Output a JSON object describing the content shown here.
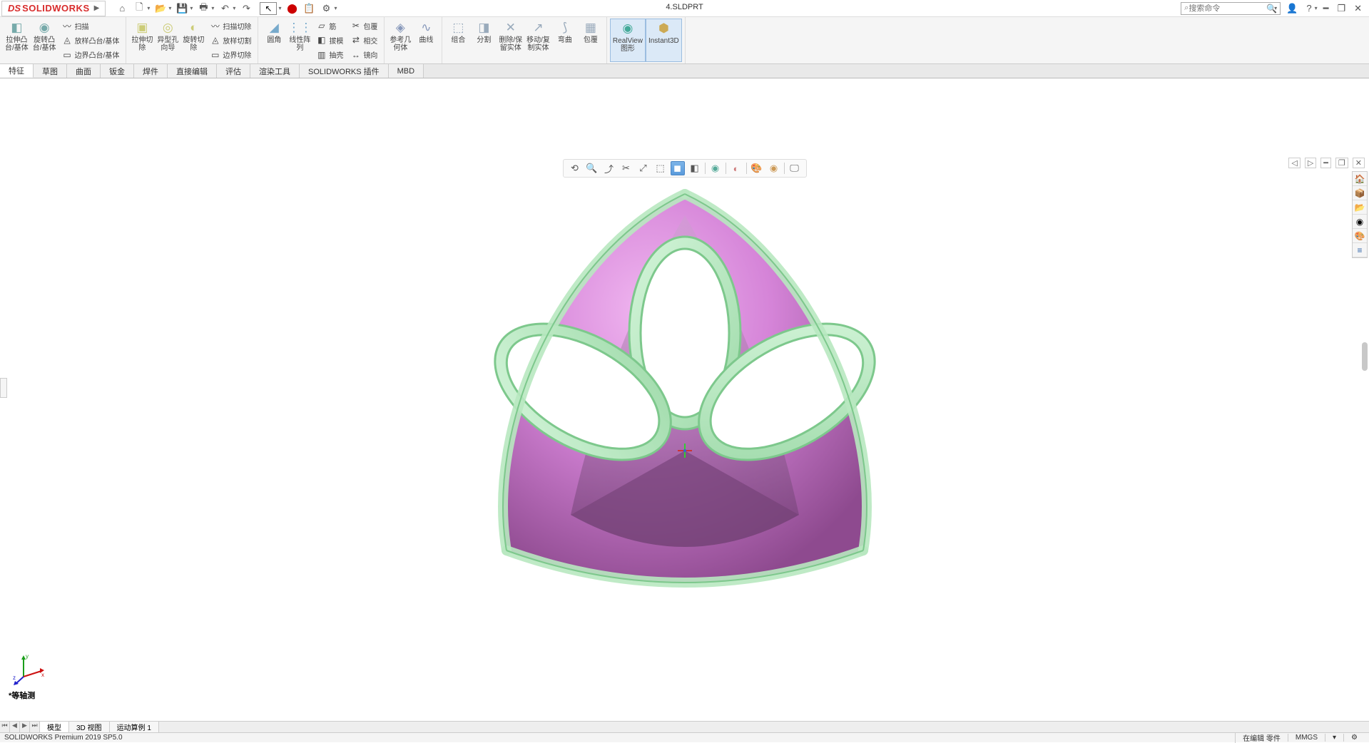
{
  "app": {
    "logo_prefix": "DS",
    "logo_text": "SOLIDWORKS",
    "document_title": "4.SLDPRT",
    "search_placeholder": "搜索命令"
  },
  "qat_icons": [
    "home",
    "new",
    "open",
    "save",
    "print",
    "undo",
    "redo"
  ],
  "ribbon": {
    "groups": {
      "features1": [
        {
          "icon": "◧",
          "label": "拉伸凸\n台/基体"
        },
        {
          "icon": "◉",
          "label": "旋转凸\n台/基体"
        }
      ],
      "features1_stack": [
        {
          "icon": "〰",
          "label": "扫描"
        },
        {
          "icon": "◬",
          "label": "放样凸台/基体"
        },
        {
          "icon": "▭",
          "label": "边界凸台/基体"
        }
      ],
      "features2": [
        {
          "icon": "▣",
          "label": "拉伸切\n除"
        },
        {
          "icon": "◎",
          "label": "异型孔\n向导"
        },
        {
          "icon": "◐",
          "label": "旋转切\n除"
        }
      ],
      "features2_stack": [
        {
          "icon": "〰",
          "label": "扫描切除"
        },
        {
          "icon": "◬",
          "label": "放样切割"
        },
        {
          "icon": "▭",
          "label": "边界切除"
        }
      ],
      "features3": [
        {
          "icon": "◢",
          "label": "圆角"
        },
        {
          "icon": "⋮⋮",
          "label": "线性阵\n列"
        }
      ],
      "features3_stack": [
        {
          "icon": "▱",
          "label": "筋"
        },
        {
          "icon": "◧",
          "label": "拔模"
        },
        {
          "icon": "▥",
          "label": "抽壳"
        }
      ],
      "features3_stack2": [
        {
          "icon": "✂",
          "label": "包覆"
        },
        {
          "icon": "⇄",
          "label": "相交"
        },
        {
          "icon": "↔",
          "label": "镜向"
        }
      ],
      "ref": [
        {
          "icon": "◈",
          "label": "参考几\n何体"
        },
        {
          "icon": "∿",
          "label": "曲线"
        }
      ],
      "bodies": [
        {
          "icon": "⬚",
          "label": "组合"
        },
        {
          "icon": "◨",
          "label": "分割"
        },
        {
          "icon": "✕",
          "label": "删除/保\n留实体"
        },
        {
          "icon": "↗",
          "label": "移动/复\n制实体"
        },
        {
          "icon": "⟆",
          "label": "弯曲"
        },
        {
          "icon": "▦",
          "label": "包覆"
        }
      ],
      "display": [
        {
          "icon": "◉",
          "label": "RealView\n图形",
          "active": true
        },
        {
          "icon": "⬢",
          "label": "Instant3D",
          "active": true
        }
      ]
    }
  },
  "tabs": [
    "特征",
    "草图",
    "曲面",
    "钣金",
    "焊件",
    "直接编辑",
    "评估",
    "渲染工具",
    "SOLIDWORKS 插件",
    "MBD"
  ],
  "active_tab": "特征",
  "view_toolbar_icons": [
    "⟲",
    "🔍",
    "⤴",
    "⤢",
    "🔎",
    "⬚",
    "⬛",
    "⬜",
    "◧",
    "·",
    "🎨",
    "◐",
    "🌐",
    "·",
    "🖵"
  ],
  "right_flyout_icons": [
    "🏠",
    "📦",
    "📂",
    "◉",
    "🎨",
    "≡"
  ],
  "triad_axes": {
    "x": "x",
    "y": "y",
    "z": "z"
  },
  "view_label": "*等轴测",
  "bottom_tabs": [
    "模型",
    "3D 视图",
    "运动算例 1"
  ],
  "active_bottom_tab": "模型",
  "status": {
    "version": "SOLIDWORKS Premium 2019 SP5.0",
    "state": "在编辑 零件",
    "units": "MMGS"
  },
  "colors": {
    "magenta": "#d584d8",
    "magenta_dark": "#8e4a8f",
    "green": "#b8e8c0",
    "green_edge": "#7dc88c"
  }
}
